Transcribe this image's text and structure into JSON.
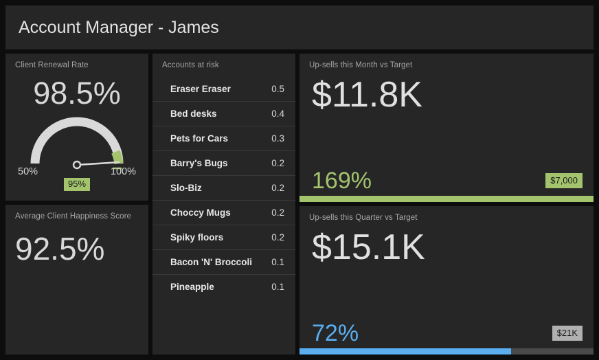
{
  "header": {
    "title": "Account Manager - James"
  },
  "renewal": {
    "title": "Client Renewal Rate",
    "value": "98.5%",
    "axis_min": "50%",
    "axis_max": "100%",
    "target_badge": "95%",
    "gauge": {
      "min": 50,
      "max": 100,
      "value": 98.5,
      "target": 95,
      "arc_color": "#d9d9d9",
      "target_color": "#a3c46d",
      "needle_color": "#d9d9d9"
    }
  },
  "happiness": {
    "title": "Average Client Happiness Score",
    "value": "92.5%"
  },
  "accounts_at_risk": {
    "title": "Accounts at risk",
    "rows": [
      {
        "name": "Eraser Eraser",
        "value": "0.5"
      },
      {
        "name": "Bed desks",
        "value": "0.4"
      },
      {
        "name": "Pets for Cars",
        "value": "0.3"
      },
      {
        "name": "Barry's Bugs",
        "value": "0.2"
      },
      {
        "name": "Slo-Biz",
        "value": "0.2"
      },
      {
        "name": "Choccy Mugs",
        "value": "0.2"
      },
      {
        "name": "Spiky floors",
        "value": "0.2"
      },
      {
        "name": "Bacon 'N' Broccoli",
        "value": "0.1"
      },
      {
        "name": "Pineapple",
        "value": "0.1"
      }
    ]
  },
  "upsells_month": {
    "title": "Up-sells this Month vs Target",
    "value": "$11.8K",
    "percent": "169%",
    "target": "$7,000",
    "bar_fill_percent": 100,
    "accent": "#a3c46d"
  },
  "upsells_quarter": {
    "title": "Up-sells this Quarter vs Target",
    "value": "$15.1K",
    "percent": "72%",
    "target": "$21K",
    "bar_fill_percent": 72,
    "accent": "#5aaef0"
  },
  "theme": {
    "page_bg": "#0d0d0d",
    "panel_bg": "#262626",
    "text": "#e0e0e0",
    "muted": "#a6a6a6",
    "green": "#a3c46d",
    "blue": "#5aaef0",
    "gray_pill": "#b0b0b0"
  }
}
